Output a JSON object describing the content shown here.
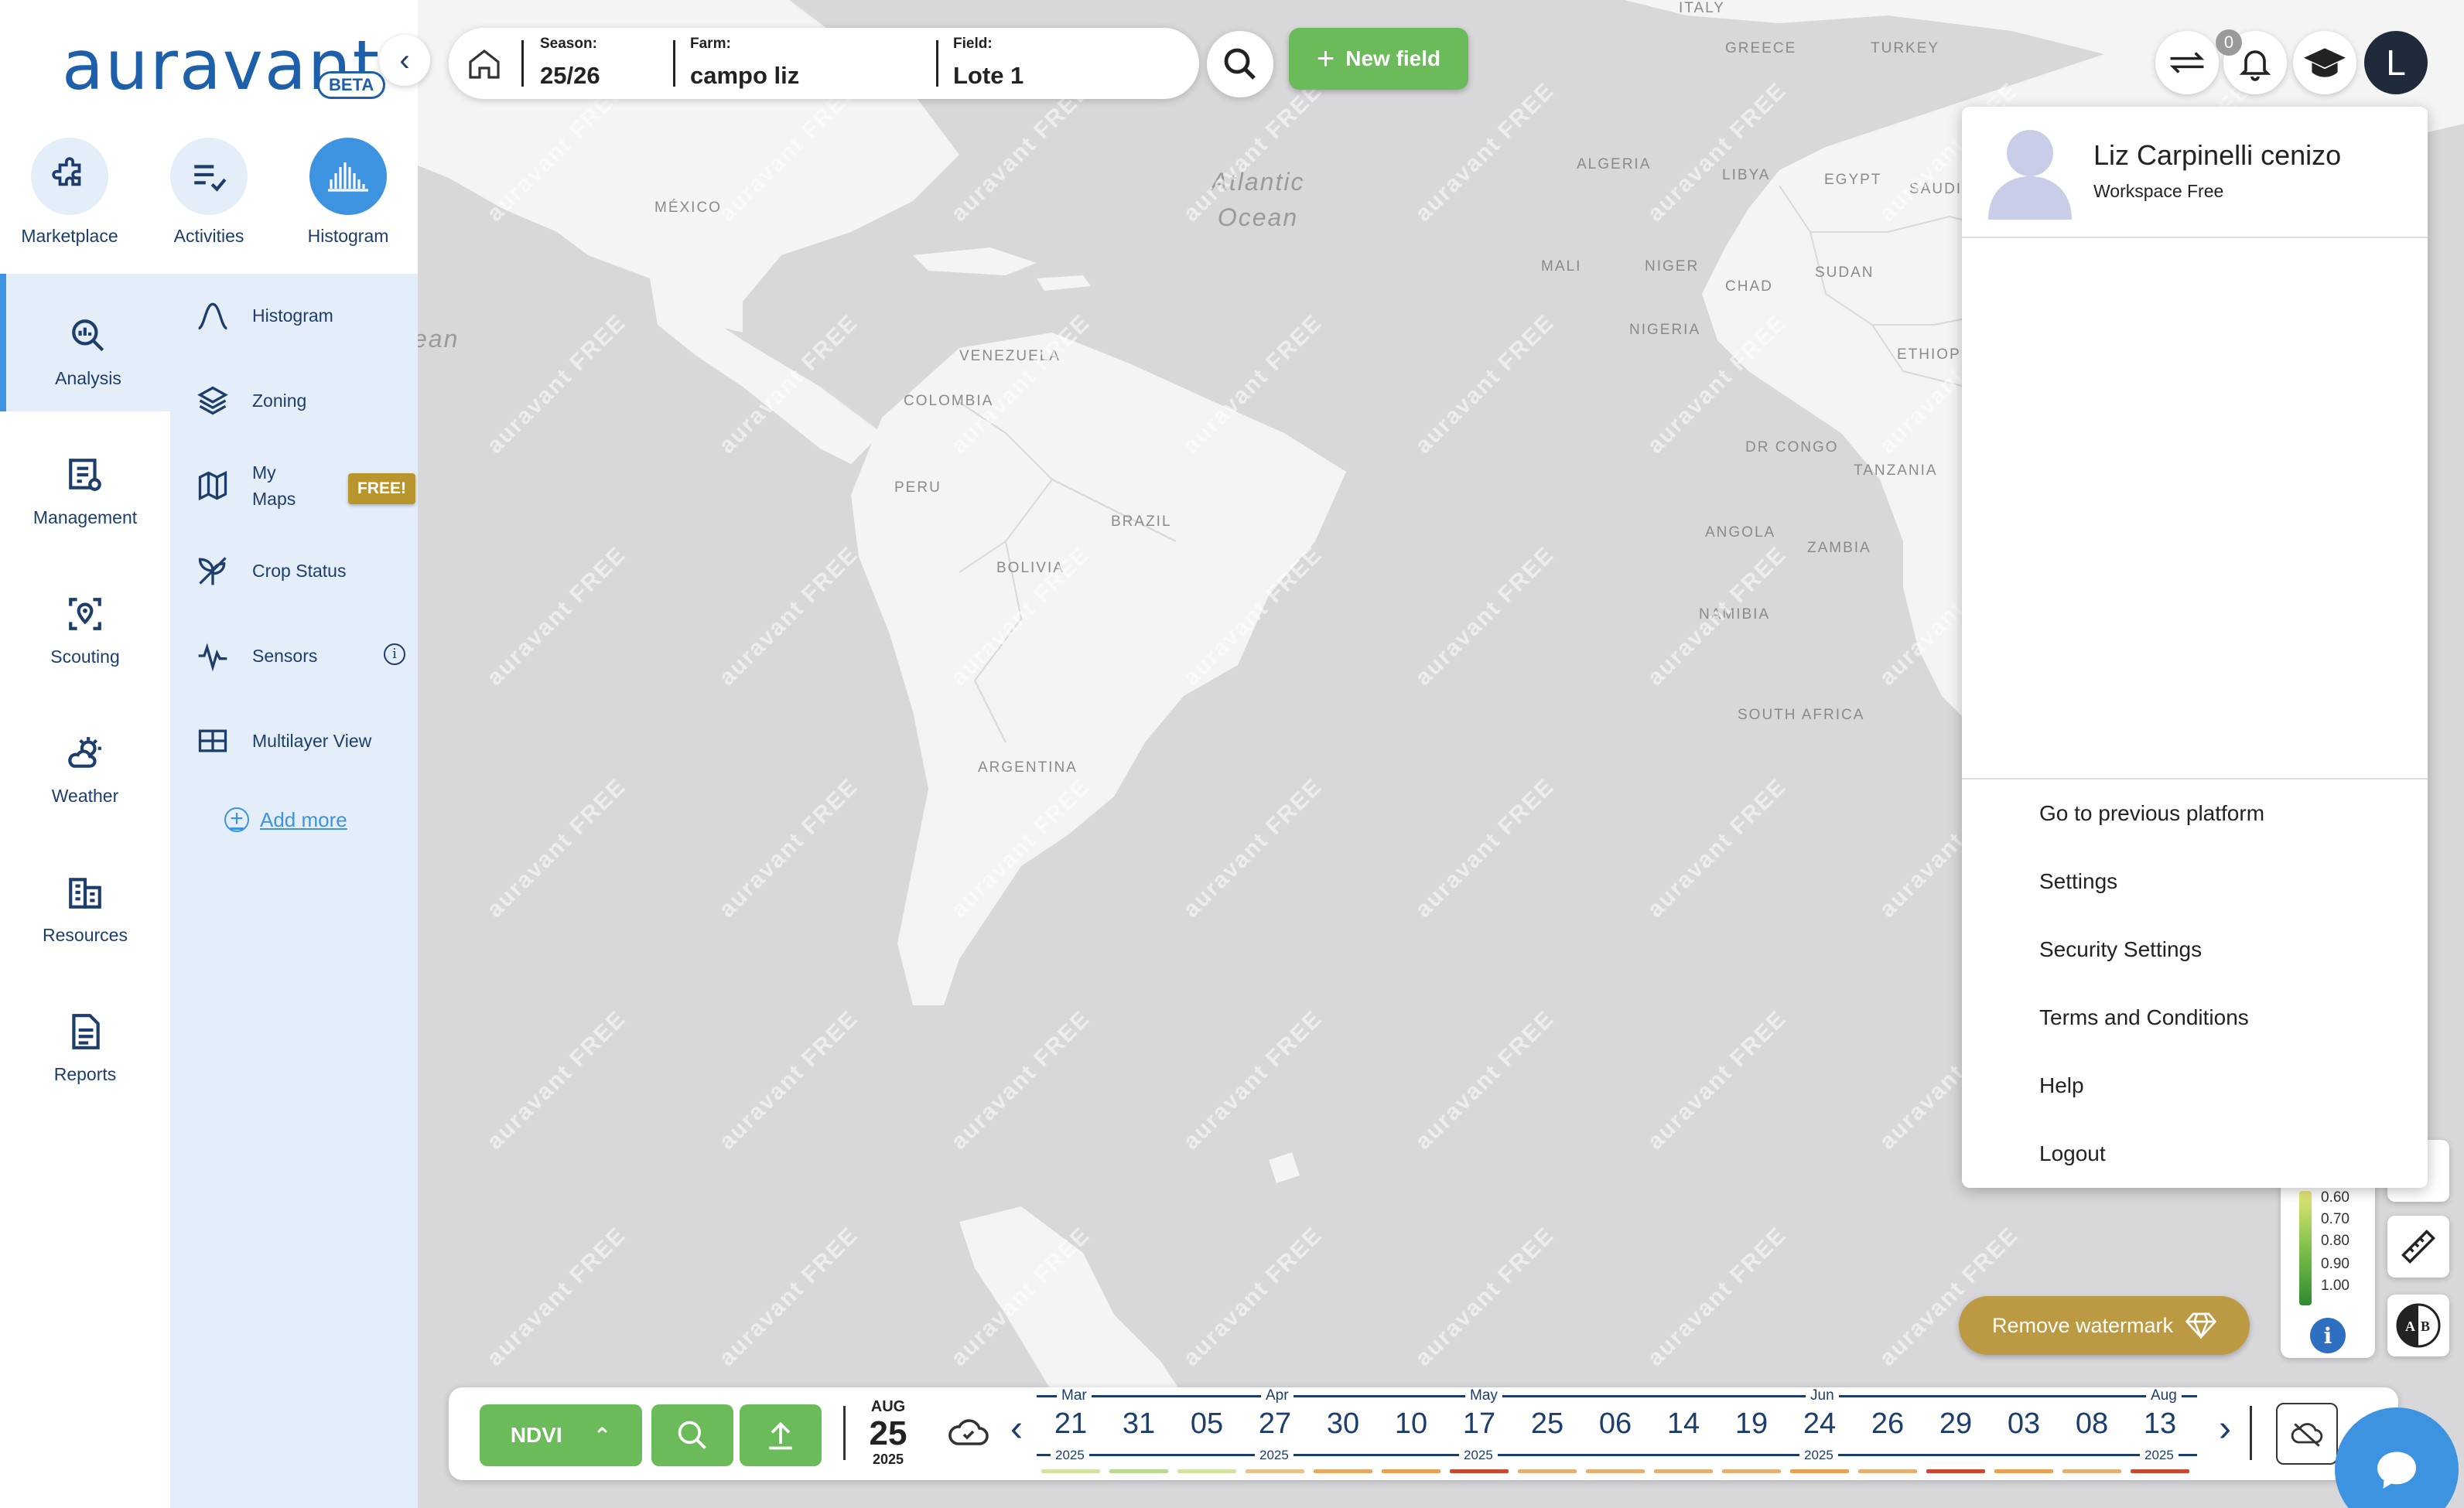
{
  "brand": {
    "logo": "auravant",
    "beta": "BETA"
  },
  "top_nav": [
    {
      "label": "Marketplace",
      "icon": "puzzle-icon"
    },
    {
      "label": "Activities",
      "icon": "checklist-icon"
    },
    {
      "label": "Histogram",
      "icon": "histogram-icon",
      "active": true
    }
  ],
  "main_nav": [
    {
      "label": "Analysis",
      "icon": "analysis-icon",
      "active": true
    },
    {
      "label": "Management",
      "icon": "management-icon"
    },
    {
      "label": "Scouting",
      "icon": "scouting-icon"
    },
    {
      "label": "Weather",
      "icon": "weather-icon"
    },
    {
      "label": "Resources",
      "icon": "resources-icon"
    },
    {
      "label": "Reports",
      "icon": "reports-icon"
    }
  ],
  "sub_nav": {
    "items": [
      {
        "label": "Histogram",
        "icon": "bell-curve-icon"
      },
      {
        "label": "Zoning",
        "icon": "layers-icon"
      },
      {
        "label": "My\nMaps",
        "icon": "map-icon",
        "badge": "FREE!"
      },
      {
        "label": "Crop Status",
        "icon": "sprout-icon"
      },
      {
        "label": "Sensors",
        "icon": "pulse-icon"
      },
      {
        "label": "Multilayer View",
        "icon": "grid-icon"
      }
    ],
    "add_more": "Add more"
  },
  "topbar": {
    "season_label": "Season:",
    "season_value": "25/26",
    "farm_label": "Farm:",
    "farm_value": "campo liz",
    "field_label": "Field:",
    "field_value": "Lote 1",
    "new_field": "New field"
  },
  "notifications": {
    "count": "0"
  },
  "user": {
    "initial": "L",
    "name": "Liz Carpinelli cenizo",
    "workspace": "Workspace Free"
  },
  "user_menu": [
    "Go to previous platform",
    "Settings",
    "Security Settings",
    "Terms and Conditions",
    "Help",
    "Logout"
  ],
  "map": {
    "labels": [
      "ITALY",
      "GREECE",
      "TURKEY",
      "ALGERIA",
      "LIBYA",
      "EGYPT",
      "SAUDI",
      "MÉXICO",
      "MALI",
      "NIGER",
      "CHAD",
      "SUDAN",
      "NIGERIA",
      "ETHIOPI",
      "VENEZUELA",
      "COLOMBIA",
      "PERU",
      "BRAZIL",
      "BOLIVIA",
      "DR CONGO",
      "TANZANIA",
      "ANGOLA",
      "ZAMBIA",
      "NAMIBIA",
      "SOUTH AFRICA",
      "ARGENTINA"
    ],
    "ocean": "Atlantic\nOcean",
    "ocean_left": "ean",
    "watermark": "auravant FREE"
  },
  "legend": {
    "values": [
      "0.60",
      "0.70",
      "0.80",
      "0.90",
      "1.00"
    ],
    "info": "i"
  },
  "remove_watermark": "Remove watermark",
  "bottombar": {
    "index": "NDVI",
    "selected_date": {
      "month": "AUG",
      "day": "25",
      "year": "2025"
    },
    "timeline": [
      {
        "day": "21",
        "month": "Mar",
        "year": "2025",
        "color": "#d2e4a0"
      },
      {
        "day": "31",
        "color": "#b8da90"
      },
      {
        "day": "05",
        "color": "#d2e4a0"
      },
      {
        "day": "27",
        "month": "Apr",
        "year": "2025",
        "color": "#e8c28a"
      },
      {
        "day": "30",
        "color": "#e8a860"
      },
      {
        "day": "10",
        "color": "#e8a050"
      },
      {
        "day": "17",
        "month": "May",
        "year": "2025",
        "color": "#c9472e"
      },
      {
        "day": "25",
        "color": "#e8b070"
      },
      {
        "day": "06",
        "color": "#e8b070"
      },
      {
        "day": "14",
        "color": "#e8b070"
      },
      {
        "day": "19",
        "month": "",
        "year": "",
        "color": "#e8b070"
      },
      {
        "day": "24",
        "month": "Jun",
        "year": "2025",
        "color": "#e8a050"
      },
      {
        "day": "26",
        "color": "#e8b070"
      },
      {
        "day": "29",
        "color": "#c9472e"
      },
      {
        "day": "03",
        "color": "#e8a050"
      },
      {
        "day": "08",
        "color": "#e8b070"
      },
      {
        "day": "13",
        "month": "Aug",
        "year": "2025",
        "color": "#c9472e"
      }
    ]
  }
}
